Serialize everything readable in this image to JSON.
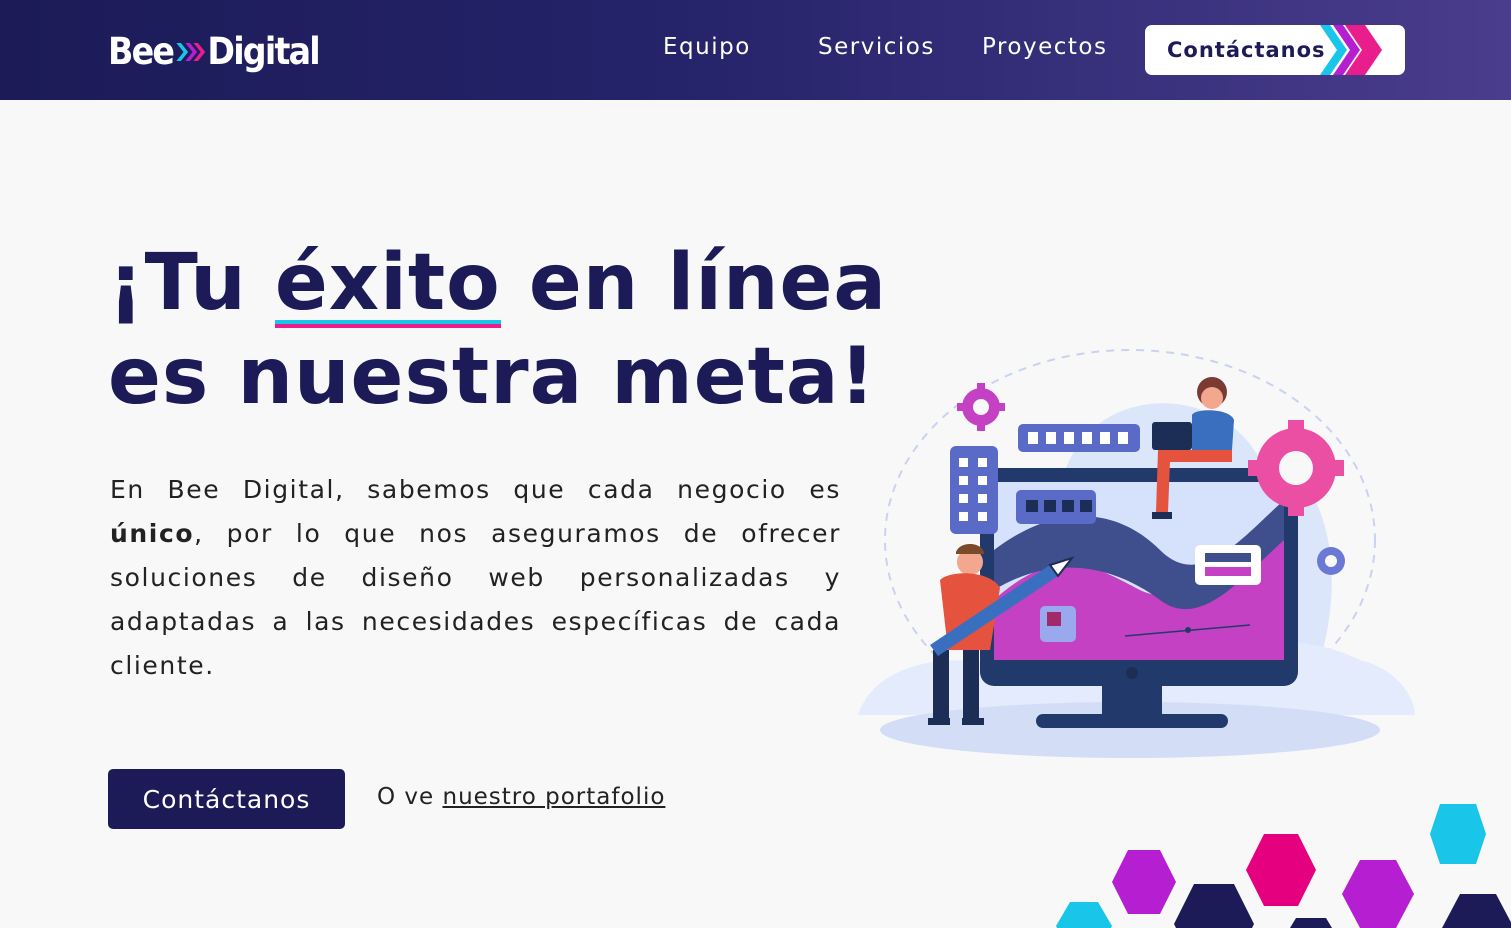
{
  "brand": {
    "logo_left": "Bee",
    "logo_right": "Digital",
    "colors": {
      "navy": "#1c1b57",
      "cyan": "#19c5e8",
      "magenta": "#e91e8c",
      "purple": "#b61fd1"
    }
  },
  "nav": {
    "items": [
      {
        "label": "Equipo"
      },
      {
        "label": "Servicios"
      },
      {
        "label": "Proyectos"
      }
    ],
    "contact_label": "Contáctanos"
  },
  "hero": {
    "title_before": "¡Tu ",
    "title_highlight": "éxito",
    "title_after": " en línea es nuestra meta!",
    "paragraph_before": "En Bee Digital, sabemos que cada negocio es ",
    "paragraph_bold": "único",
    "paragraph_after": ", por lo que nos aseguramos de ofrecer soluciones de diseño web personalizadas y adaptadas a las necesidades específicas de cada cliente.",
    "cta_label": "Contáctanos",
    "alt_prefix": "O ve ",
    "alt_link": "nuestro portafolio"
  },
  "icons": [
    "chevron-right-icon",
    "gear-icon"
  ]
}
